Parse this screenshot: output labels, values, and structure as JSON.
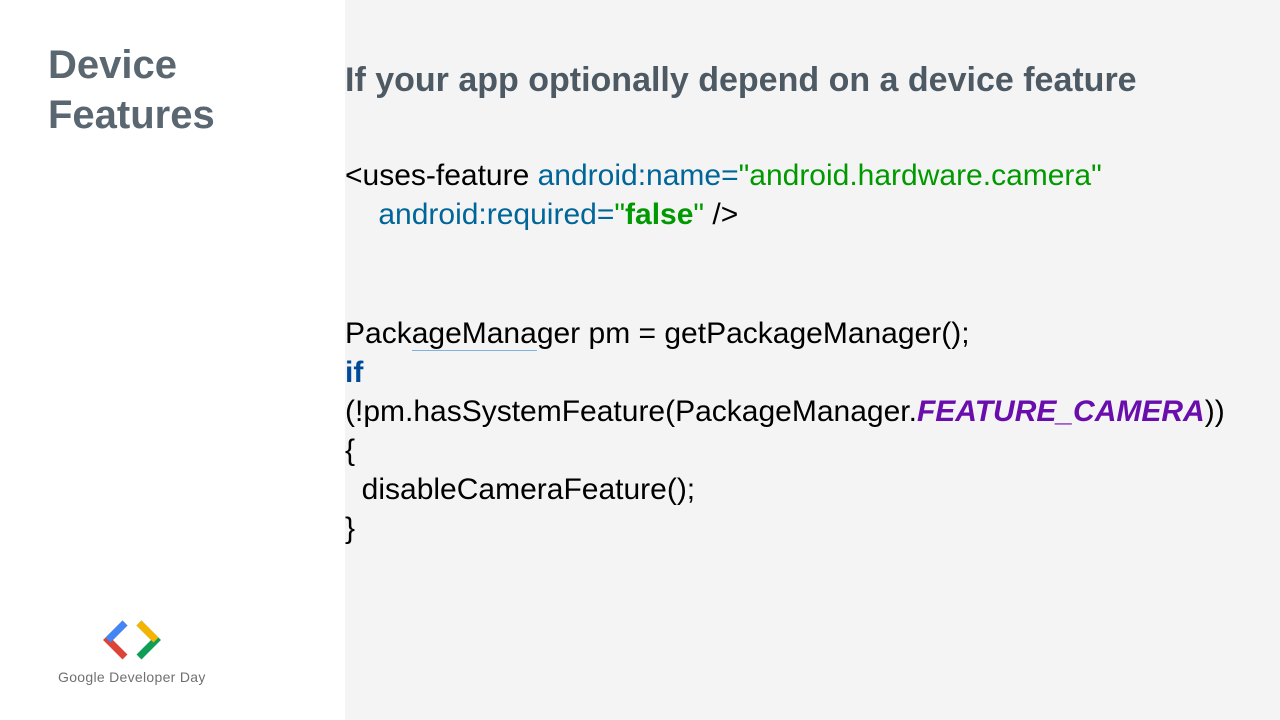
{
  "sidebar": {
    "title_line1": "Device",
    "title_line2": "Features"
  },
  "heading": "If your app optionally depend on a device feature",
  "xml": {
    "tag_open": "<uses-feature ",
    "attr_name": "android:name=",
    "attr_name_value": "\"android.hardware.camera\"",
    "attr_required": "android:required=",
    "attr_required_value_open": "\"",
    "attr_required_value": "false",
    "attr_required_value_close": "\"",
    "tag_close": " />"
  },
  "java": {
    "line1_a": "Pack",
    "line1_b": "ageMana",
    "line1_c": "ger pm = getPackageManager();",
    "line2_kw": "if",
    "line3": "(!pm.hasSystemFeature(PackageManager.",
    "line3_const": "FEATURE_CAMERA",
    "line3_close": "))",
    "line4": "{",
    "line5": "  disableCameraFeature();",
    "line6": "}"
  },
  "logo": {
    "text": "Google Developer Day"
  }
}
